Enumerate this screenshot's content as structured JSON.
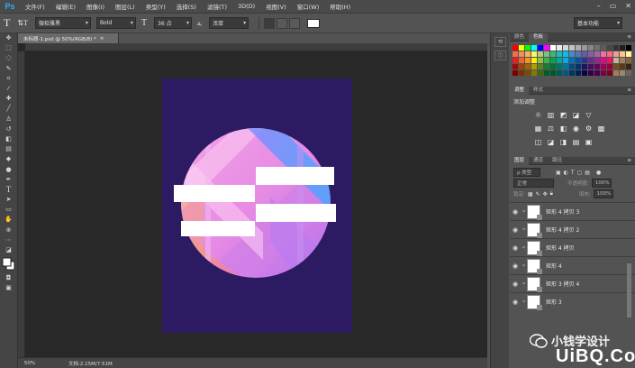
{
  "app": {
    "logo": "Ps"
  },
  "menubar": {
    "items": [
      "文件(F)",
      "编辑(E)",
      "图像(I)",
      "图层(L)",
      "类型(Y)",
      "选择(S)",
      "滤镜(T)",
      "3D(D)",
      "视图(V)",
      "窗口(W)",
      "帮助(H)"
    ],
    "window_controls": {
      "minimize": "–",
      "restore": "▭",
      "close": "✕"
    }
  },
  "options": {
    "tool_glyph": "T",
    "orientation_glyph": "⇅T",
    "font_family": "微软雅黑",
    "font_style": "Bold",
    "size_glyph": "T",
    "font_size": "36 点",
    "aa_glyph": "aₐ",
    "antialias": "浑厚",
    "workspace": "基本功能"
  },
  "document": {
    "tab_title": "未标题-1.psd @ 50%(RGB/8) *",
    "tab_close": "×",
    "zoom": "50%",
    "info": "文档:2.15M/7.51M",
    "canvas_bg": "#2c1a62"
  },
  "panels": {
    "swatches_tabs": [
      "颜色",
      "色板"
    ],
    "adjustments_tabs": [
      "调整",
      "样式"
    ],
    "adjustments_title": "添加调整",
    "layers_tabs": [
      "图层",
      "通道",
      "路径"
    ],
    "layers_filter": "ρ 类型",
    "blend_mode": "正常",
    "opacity_label": "不透明度:",
    "opacity_value": "100%",
    "lock_label": "锁定:",
    "fill_label": "填充:",
    "fill_value": "100%",
    "layers": [
      {
        "name": "矩形 4 拷贝 3"
      },
      {
        "name": "矩形 4 拷贝 2"
      },
      {
        "name": "矩形 4 拷贝"
      },
      {
        "name": "矩形 4"
      },
      {
        "name": "矩形 3 拷贝 4"
      },
      {
        "name": "矩形 3"
      }
    ],
    "swatch_colors": [
      "#ff0000",
      "#ffff00",
      "#00ff00",
      "#00ffff",
      "#0000ff",
      "#ff00ff",
      "#ffffff",
      "#ebebeb",
      "#d6d6d6",
      "#c2c2c2",
      "#adadad",
      "#999999",
      "#858585",
      "#707070",
      "#5c5c5c",
      "#474747",
      "#333333",
      "#1f1f1f",
      "#000000",
      "#f26c4f",
      "#f68e55",
      "#fbaf5c",
      "#fff467",
      "#acd372",
      "#7cc576",
      "#3bb878",
      "#1abbb4",
      "#00bff3",
      "#438cca",
      "#5574b9",
      "#605ca8",
      "#855fa8",
      "#a763a8",
      "#f06ea9",
      "#f26d7d",
      "#f4989c",
      "#fdc689",
      "#fff799",
      "#ed1c24",
      "#f26522",
      "#f7941d",
      "#fff200",
      "#8dc63f",
      "#39b54a",
      "#00a651",
      "#00a99d",
      "#00aeef",
      "#0072bc",
      "#0054a6",
      "#2e3192",
      "#662d91",
      "#92278f",
      "#ec008c",
      "#ed145b",
      "#c4b398",
      "#a0815e",
      "#8c6239",
      "#9e0b0f",
      "#a0410d",
      "#a36209",
      "#aba000",
      "#598527",
      "#1a7b30",
      "#007236",
      "#00746b",
      "#0076a3",
      "#004b80",
      "#003471",
      "#1b1464",
      "#440e62",
      "#630460",
      "#9e005d",
      "#9e0039",
      "#754c24",
      "#603913",
      "#3c2415",
      "#790000",
      "#7b2e00",
      "#7d4900",
      "#827b00",
      "#406618",
      "#005e20",
      "#005826",
      "#005952",
      "#005b7f",
      "#003663",
      "#002157",
      "#0d004c",
      "#32004b",
      "#4b0049",
      "#7b0046",
      "#7a0026",
      "#a67c52",
      "#998675",
      "#736357"
    ]
  }
}
